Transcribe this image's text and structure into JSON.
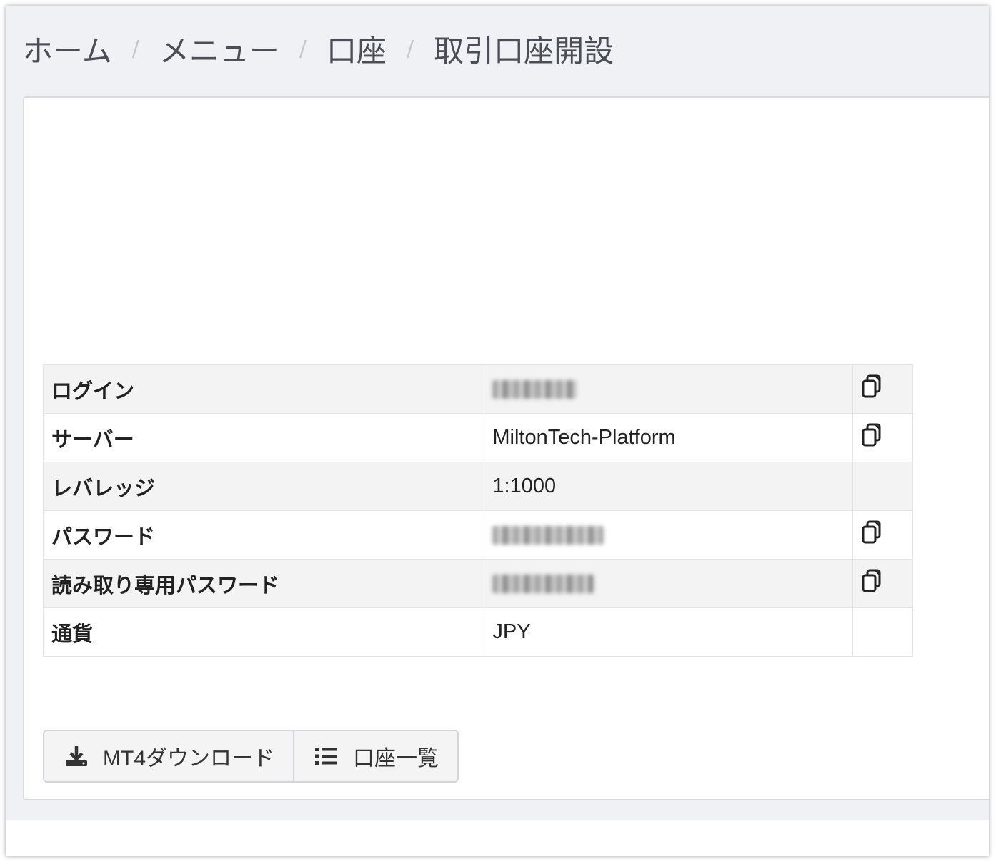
{
  "breadcrumb": {
    "items": [
      "ホーム",
      "メニュー",
      "口座",
      "取引口座開設"
    ],
    "separator": "/"
  },
  "account_table": {
    "rows": [
      {
        "label": "ログイン",
        "value": "",
        "value_hidden": true,
        "copy": true
      },
      {
        "label": "サーバー",
        "value": "MiltonTech-Platform",
        "value_hidden": false,
        "copy": true
      },
      {
        "label": "レバレッジ",
        "value": "1:1000",
        "value_hidden": false,
        "copy": false
      },
      {
        "label": "パスワード",
        "value": "",
        "value_hidden": true,
        "copy": true
      },
      {
        "label": "読み取り専用パスワード",
        "value": "",
        "value_hidden": true,
        "copy": true
      },
      {
        "label": "通貨",
        "value": "JPY",
        "value_hidden": false,
        "copy": false
      }
    ]
  },
  "actions": {
    "download_label": "MT4ダウンロード",
    "account_list_label": "口座一覧"
  },
  "icons": {
    "copy": "copy-icon",
    "download": "download-icon",
    "list": "list-icon"
  },
  "colors": {
    "page_bg": "#f0f1f5",
    "card_bg": "#ffffff",
    "row_alt": "#f3f3f3",
    "text": "#222222",
    "breadcrumb_text": "#4a4f57"
  }
}
